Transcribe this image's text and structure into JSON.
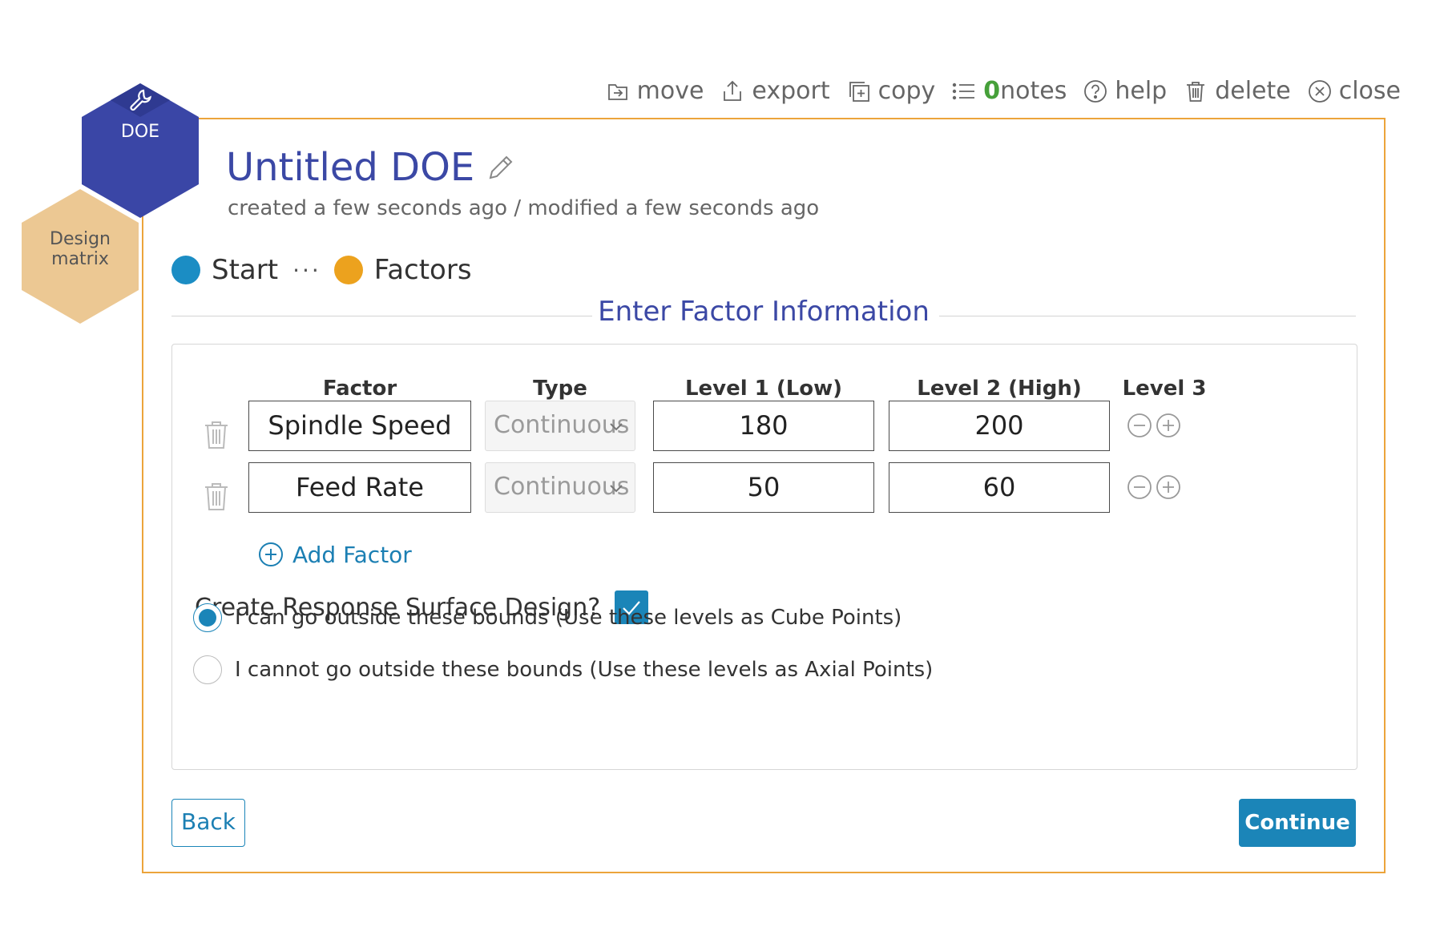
{
  "toolbar": {
    "move": "move",
    "export": "export",
    "copy": "copy",
    "notes_count": "0",
    "notes": "notes",
    "help": "help",
    "delete": "delete",
    "close": "close"
  },
  "badges": {
    "doe": "DOE",
    "design_line1": "Design",
    "design_line2": "matrix"
  },
  "header": {
    "title": "Untitled DOE",
    "meta": "created a few seconds ago / modified a few seconds ago"
  },
  "steps": [
    {
      "label": "Start",
      "color": "#1b8dc4"
    },
    {
      "label": "Factors",
      "color": "#eca21e"
    }
  ],
  "section_title": "Enter Factor Information",
  "table": {
    "headers": {
      "factor": "Factor",
      "type": "Type",
      "level1": "Level 1 (Low)",
      "level2": "Level 2 (High)",
      "level3": "Level 3"
    },
    "rows": [
      {
        "factor": "Spindle Speed",
        "type": "Continuous",
        "low": "180",
        "high": "200"
      },
      {
        "factor": "Feed Rate",
        "type": "Continuous",
        "low": "50",
        "high": "60"
      }
    ]
  },
  "add_factor": "Add Factor",
  "rsd": {
    "question": "Create Response Surface Design?",
    "checked": true
  },
  "options": [
    {
      "label": "I can go outside these bounds (Use these levels as Cube Points)",
      "selected": true
    },
    {
      "label": "I cannot go outside these bounds (Use these levels as Axial Points)",
      "selected": false
    }
  ],
  "buttons": {
    "back": "Back",
    "continue": "Continue"
  },
  "colors": {
    "accent_blue": "#1b85b8",
    "title_indigo": "#3b48a5",
    "panel_border": "#eca43b",
    "doe_hex": "#3a46a6",
    "design_hex": "#ecc893",
    "notes_green": "#46a03a"
  },
  "icons": {
    "move": "move-icon",
    "export": "export-icon",
    "copy": "copy-icon",
    "notes": "notes-list-icon",
    "help": "help-icon",
    "delete": "trash-icon",
    "close": "close-icon",
    "doe": "wrench-icon",
    "edit": "pencil-icon",
    "row_delete": "trash-icon",
    "add": "plus-circle-icon",
    "remove_level": "minus-circle-icon",
    "add_level": "plus-circle-icon",
    "dropdown": "chevron-down-icon",
    "check": "check-icon"
  }
}
